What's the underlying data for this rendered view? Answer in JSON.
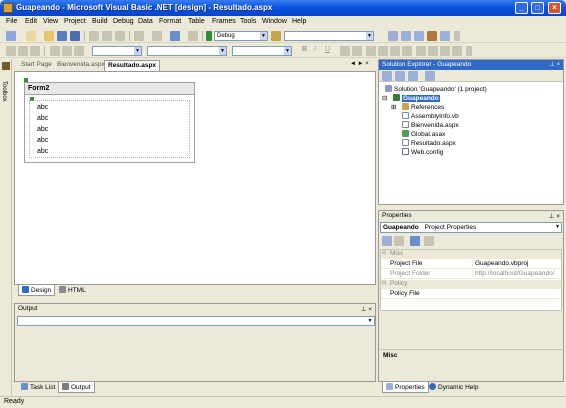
{
  "window": {
    "title": "Guapeando - Microsoft Visual Basic .NET [design] - Resultado.aspx",
    "min_glyph": "_",
    "max_glyph": "□",
    "close_glyph": "×"
  },
  "menu": [
    "File",
    "Edit",
    "View",
    "Project",
    "Build",
    "Debug",
    "Data",
    "Format",
    "Table",
    "Frames",
    "Tools",
    "Window",
    "Help"
  ],
  "toolbar": {
    "config_value": "Debug",
    "find_value": "",
    "bold": "B",
    "italic": "I",
    "underline": "U"
  },
  "toolbox_label": "Toolbox",
  "doc_tabs": [
    "Start Page",
    "Bienvenida.aspx",
    "Resultado.aspx"
  ],
  "doc_tabs_controls": "◄ ► ×",
  "form": {
    "title": "Form2",
    "labels": [
      "abc",
      "abc",
      "abc",
      "abc",
      "abc"
    ]
  },
  "designer_tabs": [
    "Design",
    "HTML"
  ],
  "output": {
    "title": "Output",
    "pins": "⊥ ×"
  },
  "output_tabs": [
    "Task List",
    "Output"
  ],
  "status": "Ready",
  "solution_explorer": {
    "title": "Solution Explorer - Guapeando",
    "pins": "⊥ ×",
    "tree": [
      {
        "label": "Solution 'Guapeando' (1 project)",
        "level": 0,
        "icon": "solution-icon",
        "selected": false
      },
      {
        "label": "Guapeando",
        "level": 1,
        "icon": "project-icon",
        "selected": true
      },
      {
        "label": "References",
        "level": 2,
        "icon": "references-icon",
        "selected": false
      },
      {
        "label": "AssemblyInfo.vb",
        "level": 2,
        "icon": "vb-file-icon",
        "selected": false
      },
      {
        "label": "Bienvenida.aspx",
        "level": 2,
        "icon": "aspx-file-icon",
        "selected": false
      },
      {
        "label": "Global.asax",
        "level": 2,
        "icon": "asax-file-icon",
        "selected": false
      },
      {
        "label": "Resultado.aspx",
        "level": 2,
        "icon": "aspx-file-icon",
        "selected": false
      },
      {
        "label": "Web.config",
        "level": 2,
        "icon": "config-file-icon",
        "selected": false
      }
    ]
  },
  "properties": {
    "title": "Properties",
    "pins": "⊥ ×",
    "object_name": "Guapeando",
    "object_type": "Project Properties",
    "rows": [
      {
        "name": "Misc",
        "value": "",
        "kind": "category"
      },
      {
        "name": "Project File",
        "value": "Guapeando.vbproj",
        "kind": "normal"
      },
      {
        "name": "Project Folder",
        "value": "http://localhost/Guapeando/",
        "kind": "gray"
      },
      {
        "name": "Policy",
        "value": "",
        "kind": "category"
      },
      {
        "name": "Policy File",
        "value": "",
        "kind": "normal"
      }
    ],
    "description": "Misc"
  },
  "props_tabs": [
    "Properties",
    "Dynamic Help"
  ],
  "colors": {
    "title_blue": "#0a54e3",
    "selection_blue": "#3169c6",
    "chrome": "#ece9d8"
  }
}
